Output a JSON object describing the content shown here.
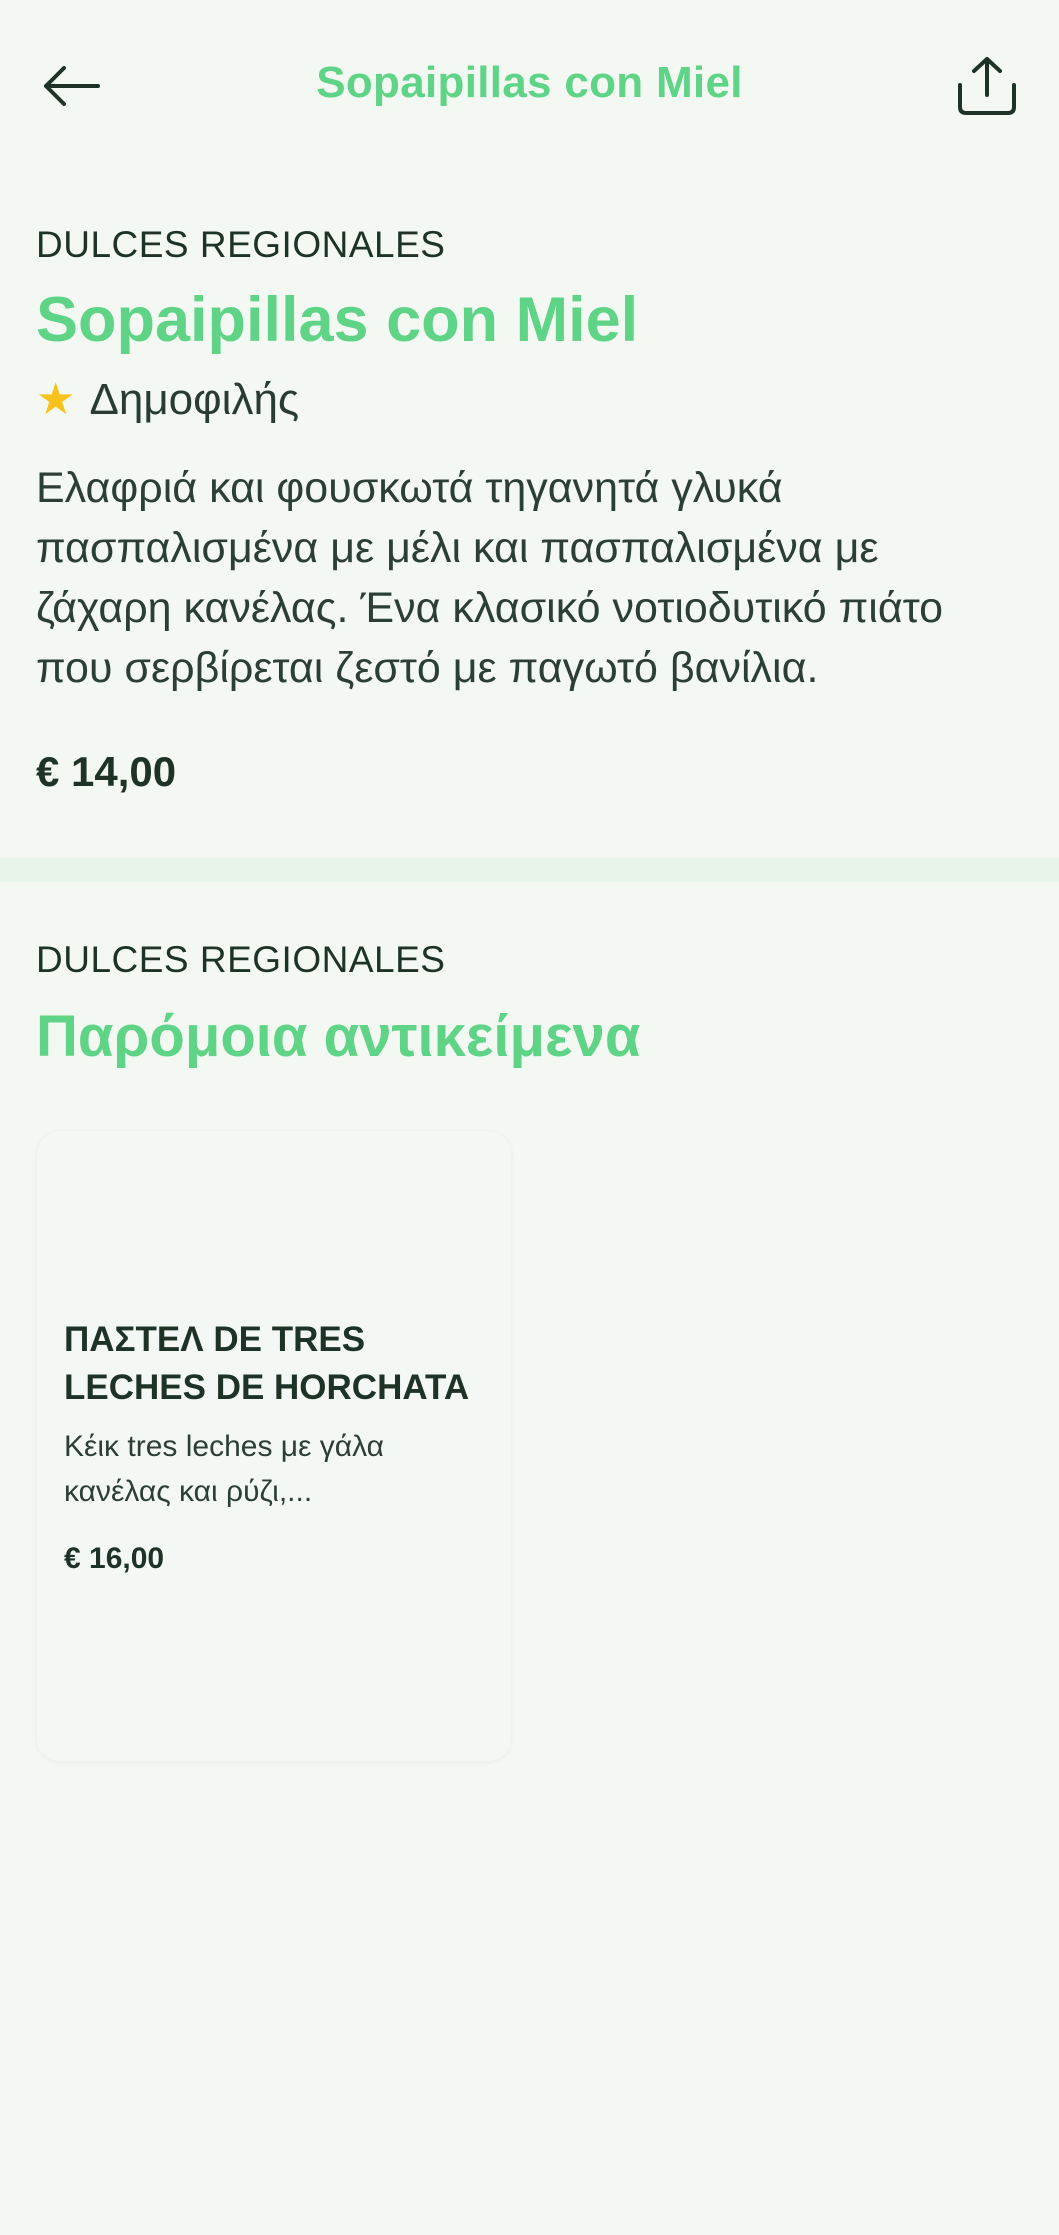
{
  "header": {
    "title": "Sopaipillas con Miel",
    "back_icon": "arrow-left-icon",
    "share_icon": "share-icon"
  },
  "item": {
    "category": "DULCES REGIONALES",
    "title": "Sopaipillas con Miel",
    "popular_label": "Δημοφιλής",
    "popular_icon": "star-icon",
    "description": "Ελαφριά και φουσκωτά τηγανητά γλυκά πασπαλισμένα με μέλι και πασπαλισμένα με ζάχαρη κανέλας. Ένα κλασικό νοτιοδυτικό πιάτο που σερβίρεται ζεστό με παγωτό βανίλια.",
    "price": "€ 14,00"
  },
  "similar": {
    "category": "DULCES REGIONALES",
    "title": "Παρόμοια αντικείμενα",
    "items": [
      {
        "name": "ΠΑΣΤΕΛ DE TRES LECHES DE HORCHATA",
        "description": "Κέικ tres leches με γάλα κανέλας και ρύζι,...",
        "price": "€ 16,00"
      }
    ]
  },
  "colors": {
    "accent": "#5fd386",
    "background": "#f3f8f3",
    "text": "#1e3326",
    "star": "#f7c21b"
  }
}
